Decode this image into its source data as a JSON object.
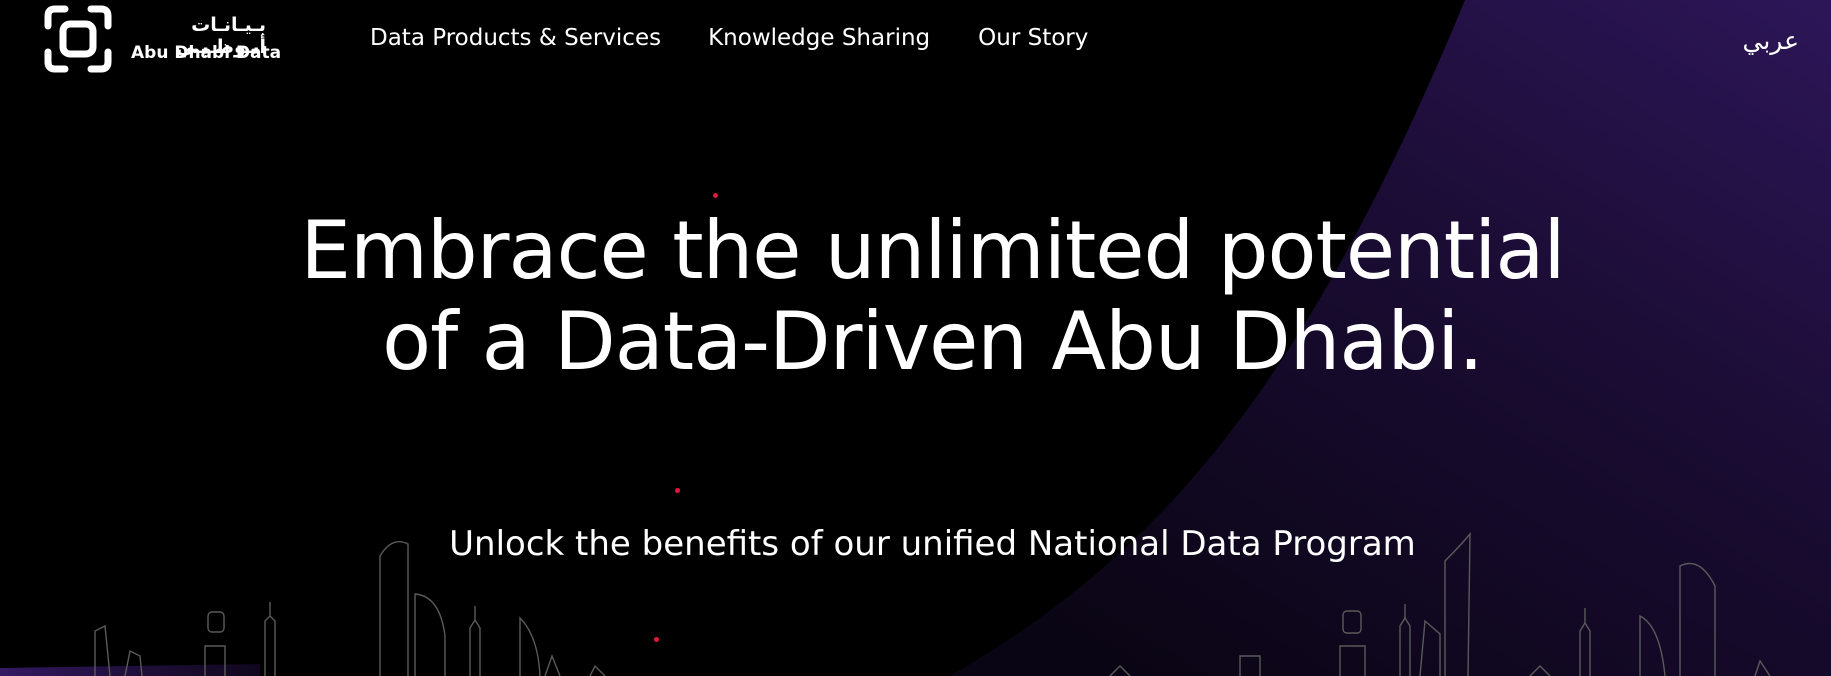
{
  "header": {
    "logo": {
      "arabic_text": "بـيـانـات أبـوظـبـي",
      "english_text": "Abu Dhabi Data",
      "icon": "bracket-square-logo-icon"
    },
    "nav": [
      {
        "label": "Data Products & Services"
      },
      {
        "label": "Knowledge Sharing"
      },
      {
        "label": "Our Story"
      }
    ],
    "language_toggle": "عربي"
  },
  "hero": {
    "title": "Embrace the unlimited potential of a Data-Driven Abu Dhabi.",
    "subtitle": "Unlock the benefits of our unified National Data Program"
  },
  "colors": {
    "background": "#000000",
    "text": "#ffffff",
    "accent_dot": "#e3173d",
    "swoosh_purple": "#2a1550",
    "skyline_stroke": "#5a5a5a"
  }
}
